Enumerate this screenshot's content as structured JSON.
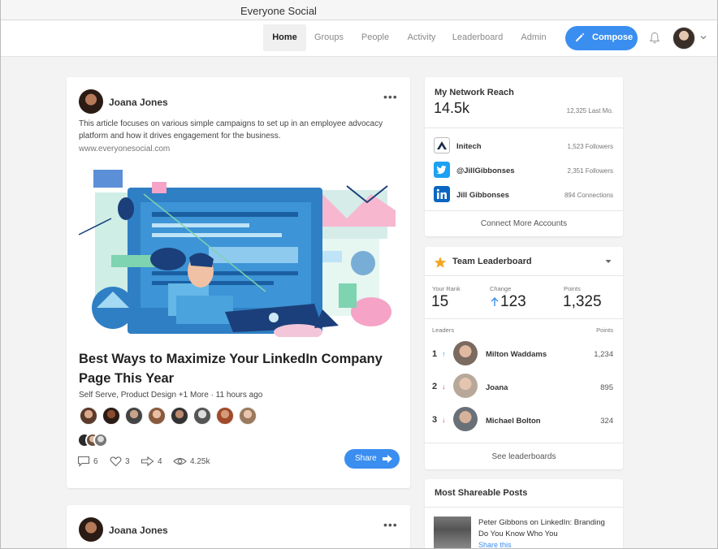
{
  "window": {
    "title": "Everyone Social"
  },
  "nav": {
    "items": [
      "Home",
      "Groups",
      "People",
      "Activity",
      "Leaderboard",
      "Admin"
    ],
    "active": "Home",
    "compose_label": "Compose"
  },
  "post": {
    "author": "Joana Jones",
    "description": "This article focuses on various simple campaigns to set up in an employee advocacy platform and how it drives engagement for the business.",
    "url": "www.everyonesocial.com",
    "title": "Best Ways to Maximize Your LinkedIn Company Page This Year",
    "meta": "Self Serve, Product Design +1 More  ·  11 hours ago",
    "stats": {
      "comments": "6",
      "likes": "3",
      "shares": "4",
      "views": "4.25k"
    },
    "share_label": "Share"
  },
  "post2": {
    "author": "Joana Jones"
  },
  "network_reach": {
    "heading": "My Network Reach",
    "total": "14.5k",
    "last_month": "12,325 Last Mo.",
    "accounts": [
      {
        "name": "Initech",
        "count": "1,523 Followers",
        "icon": "initech-logo-icon"
      },
      {
        "name": "@JillGibbonses",
        "count": "2,351 Followers",
        "icon": "twitter-icon"
      },
      {
        "name": "Jill Gibbonses",
        "count": "894 Connections",
        "icon": "linkedin-icon"
      }
    ],
    "connect_label": "Connect More Accounts"
  },
  "leaderboard": {
    "heading": "Team Leaderboard",
    "your_rank_label": "Your Rank",
    "your_rank": "15",
    "change_label": "Change",
    "change": "123",
    "points_label": "Points",
    "points": "1,325",
    "leaders_label": "Leaders",
    "leaders_points_label": "Points",
    "leaders": [
      {
        "rank": "1",
        "name": "Milton Waddams",
        "points": "1,234",
        "trend": "up"
      },
      {
        "rank": "2",
        "name": "Joana",
        "points": "895",
        "trend": "down"
      },
      {
        "rank": "3",
        "name": "Michael Bolton",
        "points": "324",
        "trend": "down"
      }
    ],
    "see_label": "See leaderboards"
  },
  "shareable": {
    "heading": "Most Shareable Posts",
    "post_title": "Peter Gibbons on LinkedIn: Branding Do You Know Who You",
    "link_label": "Share this"
  },
  "colors": {
    "accent": "#3a8ef0",
    "twitter": "#1da1f2",
    "linkedin": "#0a66c2",
    "star": "#f5a623",
    "up": "#3a8ef0",
    "down": "#e2404a"
  }
}
